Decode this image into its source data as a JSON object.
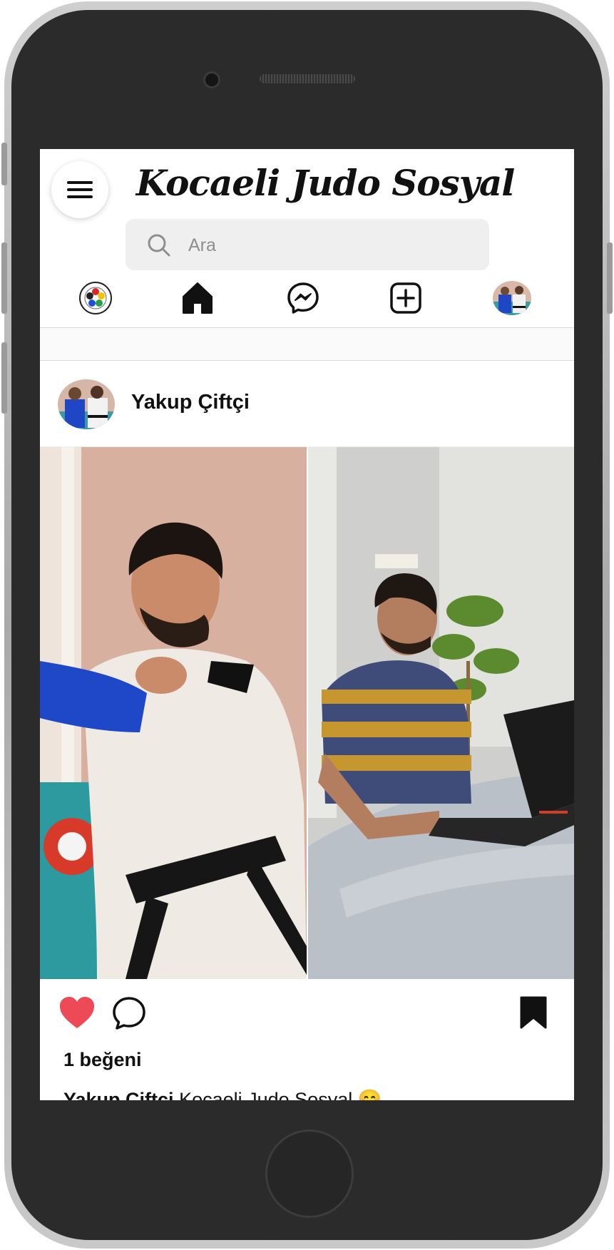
{
  "app": {
    "brand": "Kocaeli Judo Sosyal"
  },
  "header": {
    "menu_icon": "hamburger-icon",
    "search": {
      "placeholder": "Ara",
      "value": "",
      "icon": "search-icon"
    }
  },
  "nav": {
    "items": [
      {
        "name": "judo-federation-logo",
        "icon": "federation-emblem-icon"
      },
      {
        "name": "home",
        "icon": "home-icon"
      },
      {
        "name": "messenger",
        "icon": "messenger-icon"
      },
      {
        "name": "new-post",
        "icon": "plus-square-icon"
      },
      {
        "name": "profile",
        "icon": "avatar"
      }
    ]
  },
  "post": {
    "username": "Yakup Çiftçi",
    "likes_text": "1 beğeni",
    "caption_user": "Yakup Çiftçi",
    "caption_text": "Kocaeli Judo Sosyal",
    "caption_emoji": "😊",
    "liked": true,
    "saved": true
  },
  "colors": {
    "like_red": "#ed4956",
    "search_bg": "#efefef",
    "text": "#111111"
  }
}
